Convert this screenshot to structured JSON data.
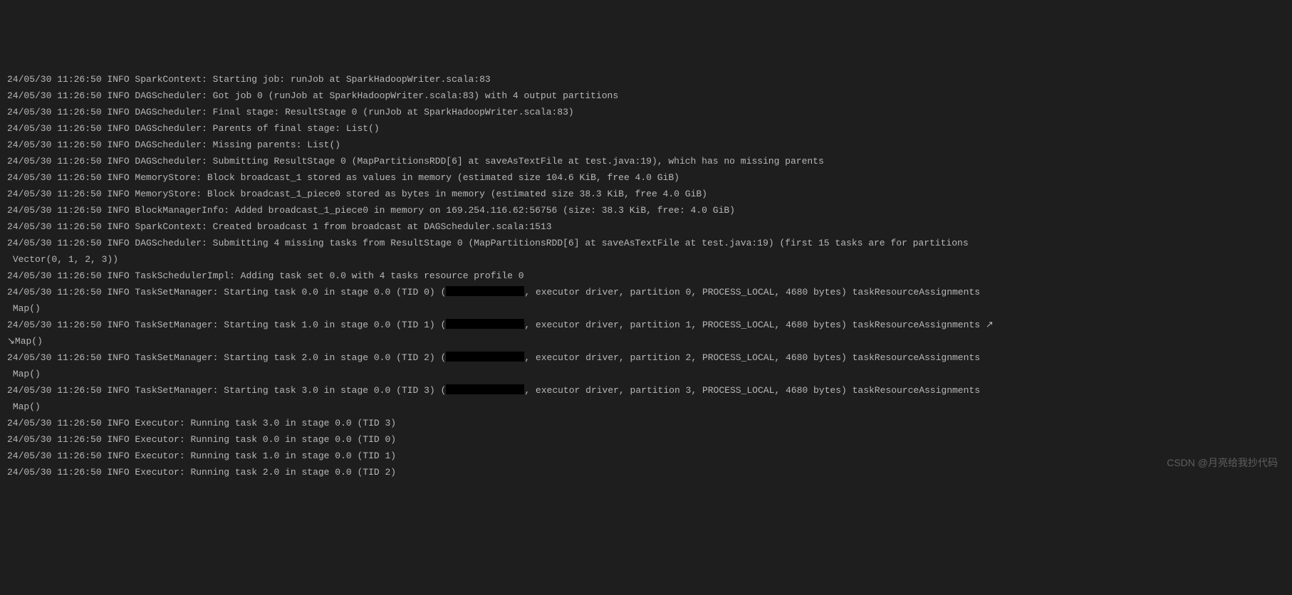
{
  "logs": [
    "24/05/30 11:26:50 INFO SparkContext: Starting job: runJob at SparkHadoopWriter.scala:83",
    "24/05/30 11:26:50 INFO DAGScheduler: Got job 0 (runJob at SparkHadoopWriter.scala:83) with 4 output partitions",
    "24/05/30 11:26:50 INFO DAGScheduler: Final stage: ResultStage 0 (runJob at SparkHadoopWriter.scala:83)",
    "24/05/30 11:26:50 INFO DAGScheduler: Parents of final stage: List()",
    "24/05/30 11:26:50 INFO DAGScheduler: Missing parents: List()",
    "24/05/30 11:26:50 INFO DAGScheduler: Submitting ResultStage 0 (MapPartitionsRDD[6] at saveAsTextFile at test.java:19), which has no missing parents",
    "24/05/30 11:26:50 INFO MemoryStore: Block broadcast_1 stored as values in memory (estimated size 104.6 KiB, free 4.0 GiB)",
    "24/05/30 11:26:50 INFO MemoryStore: Block broadcast_1_piece0 stored as bytes in memory (estimated size 38.3 KiB, free 4.0 GiB)",
    "24/05/30 11:26:50 INFO BlockManagerInfo: Added broadcast_1_piece0 in memory on 169.254.116.62:56756 (size: 38.3 KiB, free: 4.0 GiB)",
    "24/05/30 11:26:50 INFO SparkContext: Created broadcast 1 from broadcast at DAGScheduler.scala:1513",
    "24/05/30 11:26:50 INFO DAGScheduler: Submitting 4 missing tasks from ResultStage 0 (MapPartitionsRDD[6] at saveAsTextFile at test.java:19) (first 15 tasks are for partitions\n Vector(0, 1, 2, 3))",
    "24/05/30 11:26:50 INFO TaskSchedulerImpl: Adding task set 0.0 with 4 tasks resource profile 0"
  ],
  "redactedLogs": [
    {
      "prefix": "24/05/30 11:26:50 INFO TaskSetManager: Starting task 0.0 in stage 0.0 (TID 0) (",
      "suffix": ", executor driver, partition 0, PROCESS_LOCAL, 4680 bytes) taskResourceAssignments\n Map()"
    },
    {
      "prefix": "24/05/30 11:26:50 INFO TaskSetManager: Starting task 1.0 in stage 0.0 (TID 1) (",
      "suffix": ", executor driver, partition 1, PROCESS_LOCAL, 4680 bytes) taskResourceAssignments ↗\n↘Map()"
    },
    {
      "prefix": "24/05/30 11:26:50 INFO TaskSetManager: Starting task 2.0 in stage 0.0 (TID 2) (",
      "suffix": ", executor driver, partition 2, PROCESS_LOCAL, 4680 bytes) taskResourceAssignments\n Map()"
    },
    {
      "prefix": "24/05/30 11:26:50 INFO TaskSetManager: Starting task 3.0 in stage 0.0 (TID 3) (",
      "suffix": ", executor driver, partition 3, PROCESS_LOCAL, 4680 bytes) taskResourceAssignments\n Map()"
    }
  ],
  "trailingLogs": [
    "24/05/30 11:26:50 INFO Executor: Running task 3.0 in stage 0.0 (TID 3)",
    "24/05/30 11:26:50 INFO Executor: Running task 0.0 in stage 0.0 (TID 0)",
    "24/05/30 11:26:50 INFO Executor: Running task 1.0 in stage 0.0 (TID 1)",
    "24/05/30 11:26:50 INFO Executor: Running task 2.0 in stage 0.0 (TID 2)"
  ],
  "watermark": "CSDN @月亮给我抄代码"
}
